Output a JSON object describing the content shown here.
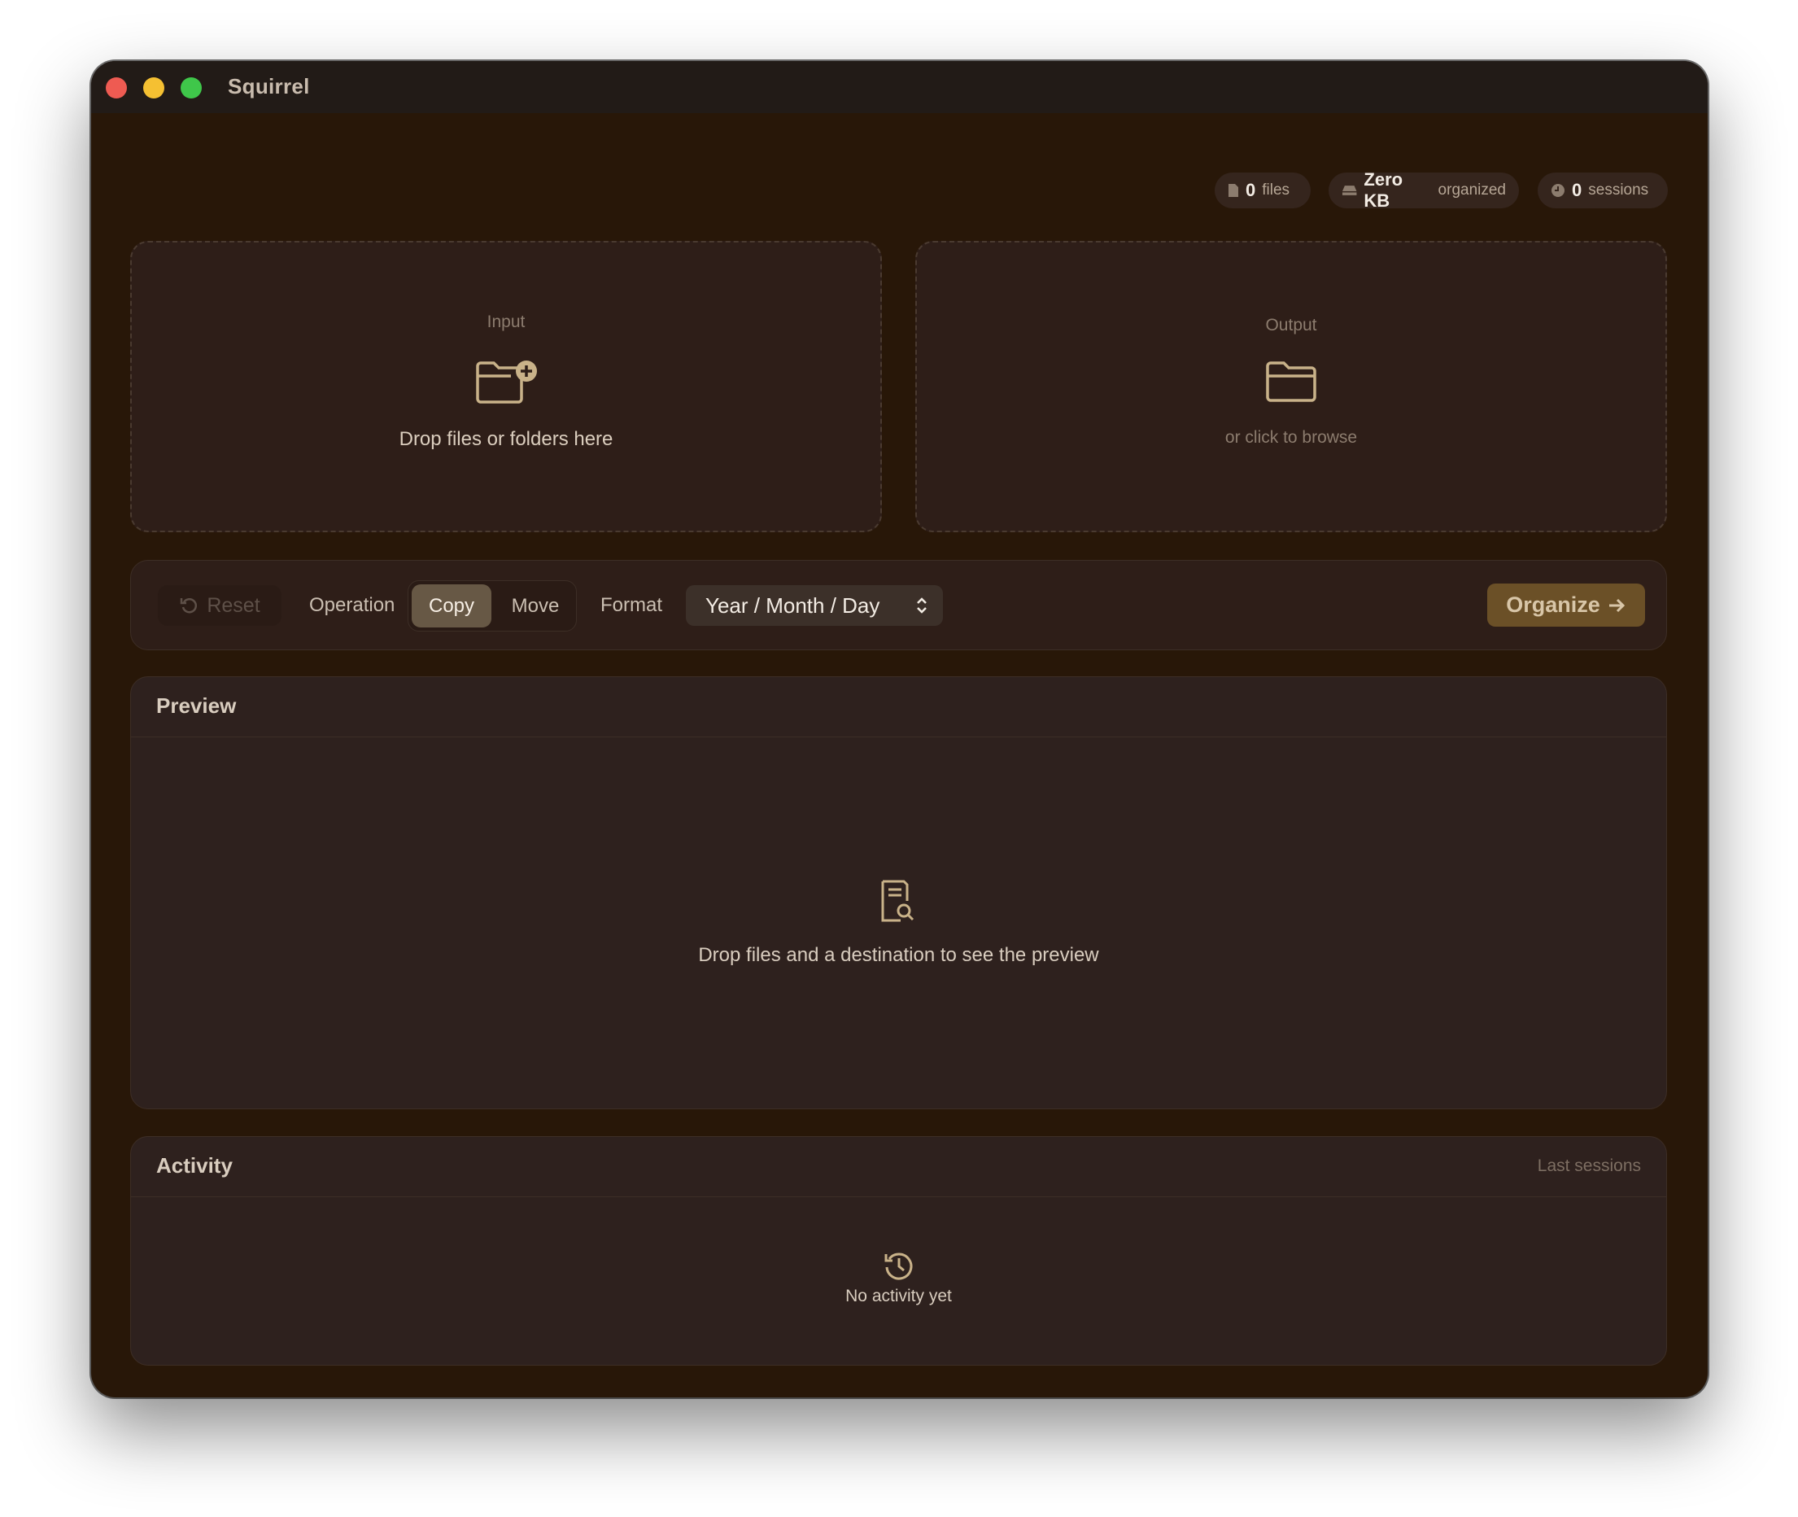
{
  "window": {
    "title": "Squirrel"
  },
  "stats": {
    "files": {
      "value": "0",
      "label": "files",
      "icon": "file-icon"
    },
    "size": {
      "value": "Zero KB",
      "label": "organized",
      "icon": "drive-icon"
    },
    "sessions": {
      "value": "0",
      "label": "sessions",
      "icon": "clock-icon"
    }
  },
  "input_zone": {
    "label": "Input",
    "text": "Drop files or folders here",
    "icon": "folder-plus-icon"
  },
  "output_zone": {
    "label": "Output",
    "text": "or click to browse",
    "icon": "folder-icon"
  },
  "toolbar": {
    "reset_label": "Reset",
    "operation_label": "Operation",
    "operations": [
      "Copy",
      "Move"
    ],
    "selected_operation": "Copy",
    "format_label": "Format",
    "format_value": "Year / Month / Day",
    "organize_label": "Organize"
  },
  "preview": {
    "title": "Preview",
    "empty_text": "Drop files and a destination to see the preview",
    "icon": "document-search-icon"
  },
  "activity": {
    "title": "Activity",
    "subtitle": "Last sessions",
    "empty_text": "No activity yet",
    "icon": "history-icon"
  },
  "colors": {
    "background": "#281708",
    "panel": "#2e211e",
    "accent": "#6b5027",
    "segment_selected": "#675845"
  }
}
